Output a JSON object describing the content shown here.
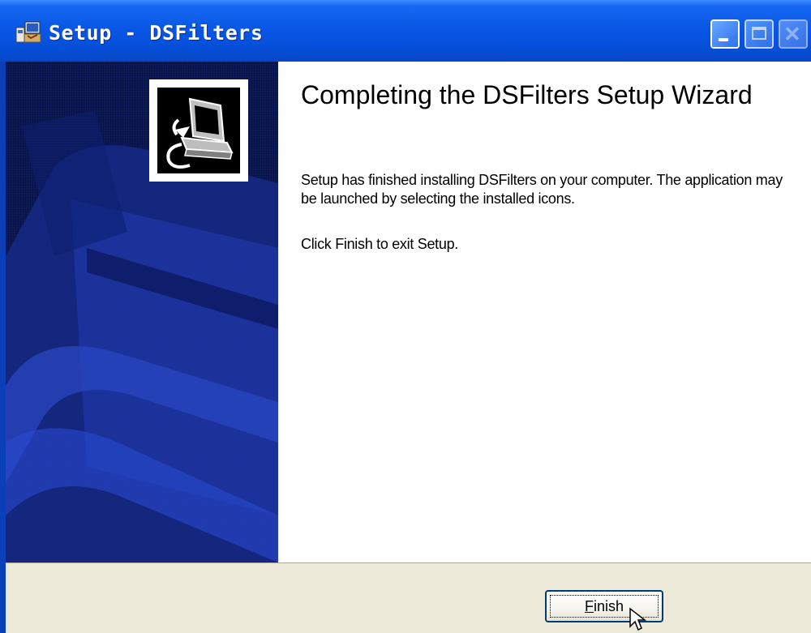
{
  "window": {
    "title": "Setup - DSFilters",
    "controls": [
      "minimize-icon",
      "maximize-icon",
      "close-icon"
    ]
  },
  "wizard": {
    "heading": "Completing the DSFilters Setup Wizard",
    "paragraph1": "Setup has finished installing DSFilters on your computer. The application may be launched by selecting the installed icons.",
    "paragraph2": "Click Finish to exit Setup."
  },
  "buttons": {
    "finish_mnemonic": "F",
    "finish_rest": "inish"
  },
  "colors": {
    "titlebar": "#0a57e6",
    "side_panel": "#0c1a5a",
    "footer": "#ece9d8"
  }
}
